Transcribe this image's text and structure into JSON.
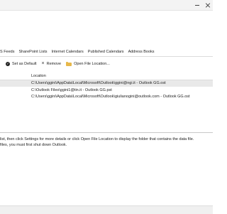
{
  "tabs": [
    "S Feeds",
    "SharePoint Lists",
    "Internet Calendars",
    "Published Calendars",
    "Address Books"
  ],
  "toolbar": {
    "set_default_label": "Set as Default",
    "remove_label": "Remove",
    "open_location_label": "Open File Location..."
  },
  "table": {
    "location_header": "Location",
    "rows": [
      "C:\\Users\\ggini\\AppData\\Local\\Microsoft\\Outlook\\ggini@ngi.it - Outlook GG.ost",
      "C:\\Outlook Files\\ggini1@tin.it - Outlook GG.pst",
      "C:\\Users\\ggini\\AppData\\Local\\Microsoft\\Outlook\\giulianogini@outlook.com - Outlook GG.ost"
    ]
  },
  "info": {
    "line1": "list, then click Settings for more details or click Open File Location to display the folder that contains the data file.",
    "line2": "files, you must first shut down Outlook."
  }
}
